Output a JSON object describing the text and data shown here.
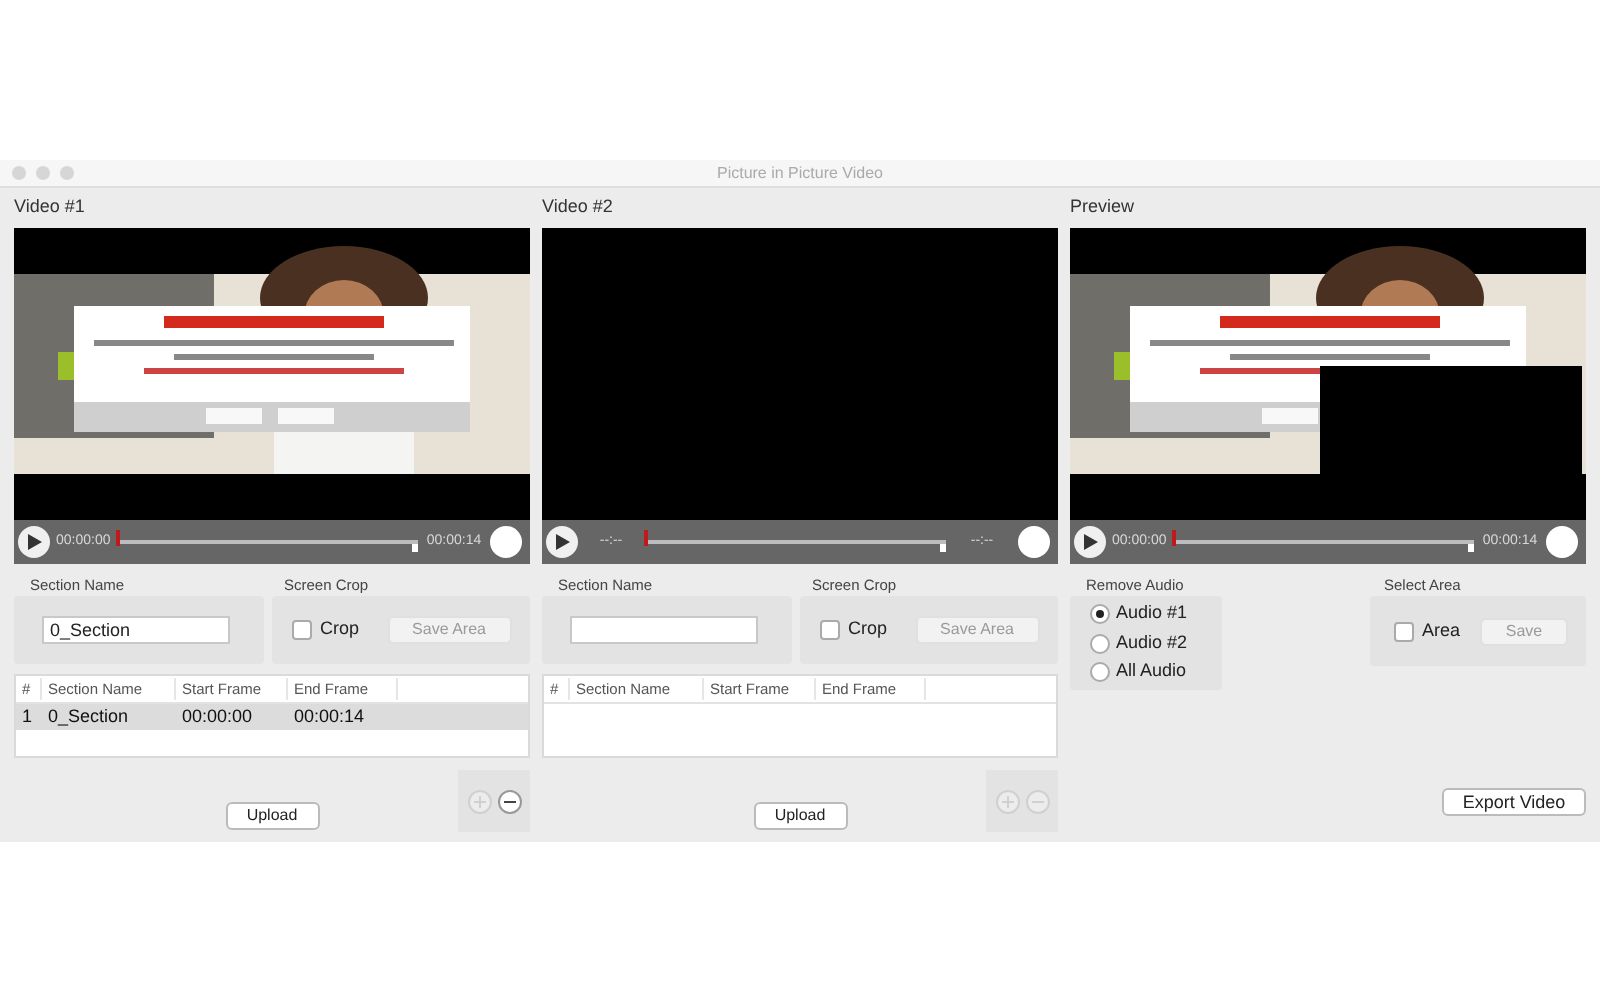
{
  "window": {
    "title": "Picture in Picture Video"
  },
  "sources": [
    {
      "title": "Video #1",
      "player": {
        "start": "00:00:00",
        "end": "00:00:14",
        "level": 0
      },
      "section_label": "Section Name",
      "section_value": "0_Section",
      "crop_label": "Screen Crop",
      "crop": {
        "label": "Crop",
        "checked": false
      },
      "save_area": {
        "label": "Save Area",
        "disabled": true
      },
      "table": {
        "columns": [
          "#",
          "Section Name",
          "Start Frame",
          "End Frame"
        ],
        "rows": [
          {
            "cells": [
              "1",
              "0_Section",
              "00:00:00",
              "00:00:14"
            ],
            "selected": true
          }
        ]
      },
      "add_disabled": true,
      "remove_disabled": false,
      "upload": "Upload"
    },
    {
      "title": "Video #2",
      "video": {
        "kind": "empty"
      },
      "player": {
        "start": "--:--",
        "end": "--:--",
        "level": 0
      },
      "section_label": "Section Name",
      "crop_label": "Screen Crop",
      "crop": {
        "label": "Crop",
        "checked": false
      },
      "save_area": {
        "label": "Save Area",
        "disabled": true
      },
      "table": {
        "columns": [
          "#",
          "Section Name",
          "Start Frame",
          "End Frame"
        ]
      },
      "add_disabled": true,
      "remove_disabled": true,
      "upload": "Upload"
    }
  ],
  "preview": {
    "title": "Preview",
    "player": {
      "start": "00:00:00",
      "end": "00:00:14",
      "level": 0
    },
    "audio_label": "Remove Audio",
    "audio_options": [
      {
        "label": "Audio #1",
        "selected": true
      },
      {
        "label": "Audio #2",
        "selected": false
      },
      {
        "label": "All Audio",
        "selected": false
      }
    ],
    "area_label": "Select Area",
    "area": {
      "label": "Area",
      "checked": false
    },
    "save": {
      "label": "Save",
      "disabled": true
    },
    "export": "Export Video"
  }
}
